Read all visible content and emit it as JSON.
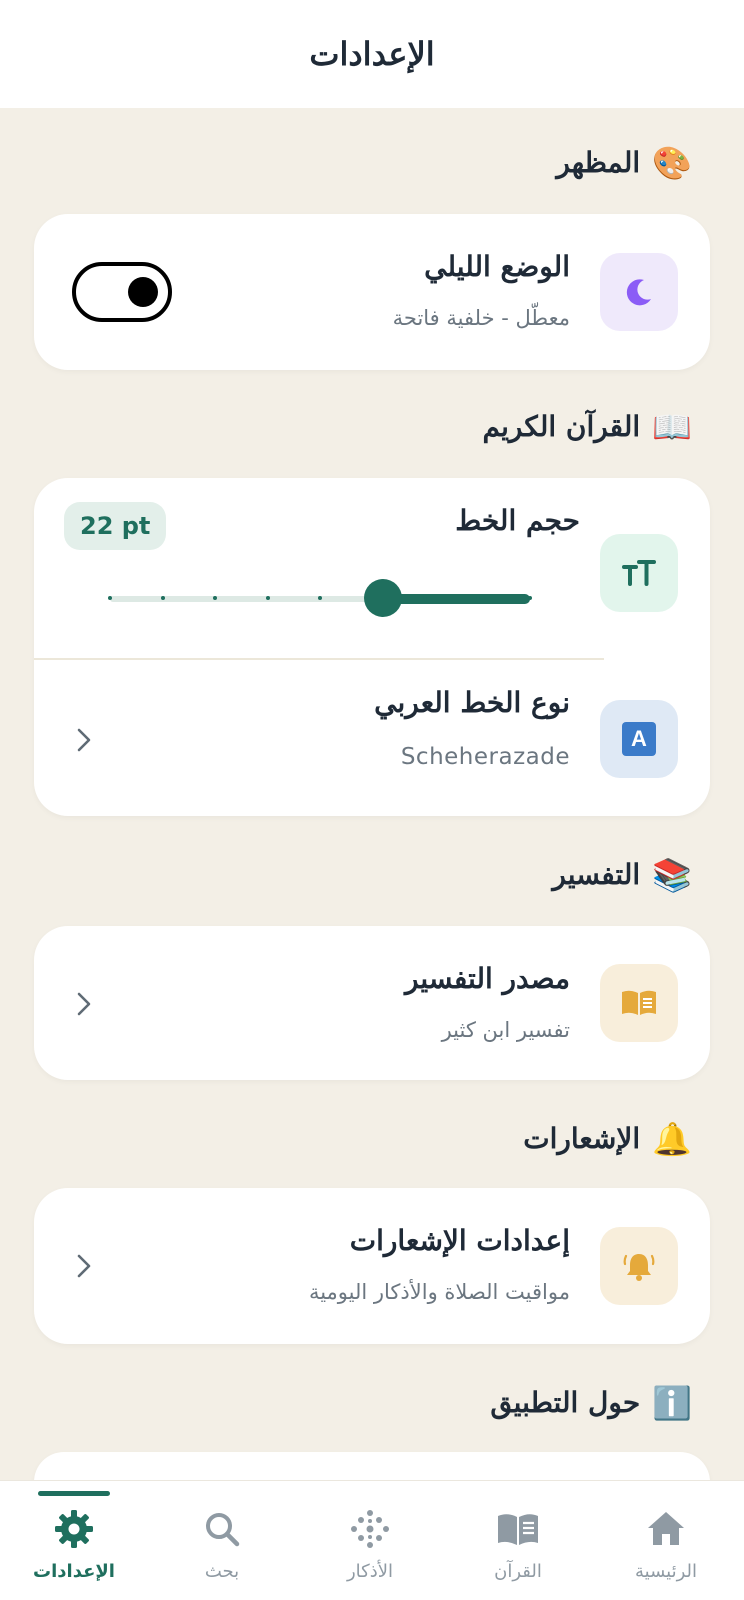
{
  "header": {
    "title": "الإعدادات"
  },
  "sections": {
    "appearance": {
      "emoji": "🎨",
      "title": "المظهر"
    },
    "quran": {
      "emoji": "📖",
      "title": "القرآن الكريم"
    },
    "tafsir": {
      "emoji": "📚",
      "title": "التفسير"
    },
    "notifications": {
      "emoji": "🔔",
      "title": "الإشعارات"
    },
    "about": {
      "emoji": "ℹ️",
      "title": "حول التطبيق"
    }
  },
  "night_mode": {
    "title": "الوضع الليلي",
    "subtitle": "معطّل - خلفية فاتحة",
    "enabled": false
  },
  "font_size": {
    "title": "حجم الخط",
    "value_label": "22 pt",
    "slider_fraction": 0.35
  },
  "arabic_font": {
    "title": "نوع الخط العربي",
    "subtitle": "Scheherazade",
    "icon_letter": "A"
  },
  "tafsir_source": {
    "title": "مصدر التفسير",
    "subtitle": "تفسير ابن كثير"
  },
  "notification_settings": {
    "title": "إعدادات الإشعارات",
    "subtitle": "مواقيت الصلاة والأذكار اليومية"
  },
  "nav": {
    "items": [
      {
        "label": "الإعدادات",
        "icon": "gear-icon",
        "active": true
      },
      {
        "label": "بحث",
        "icon": "search-icon",
        "active": false
      },
      {
        "label": "الأذكار",
        "icon": "dots-icon",
        "active": false
      },
      {
        "label": "القرآن",
        "icon": "book-icon",
        "active": false
      },
      {
        "label": "الرئيسية",
        "icon": "home-icon",
        "active": false
      }
    ]
  },
  "colors": {
    "accent": "#1f6f5e",
    "background": "#f3efe6",
    "card": "#ffffff",
    "moon_bg": "#efe9fb",
    "moon": "#8b5cf6",
    "tt_bg": "#e2f5ec",
    "a_bg": "#dfe9f5",
    "a_fill": "#3b7bc9",
    "book_bg": "#f8eedb",
    "book": "#e5a93b"
  }
}
